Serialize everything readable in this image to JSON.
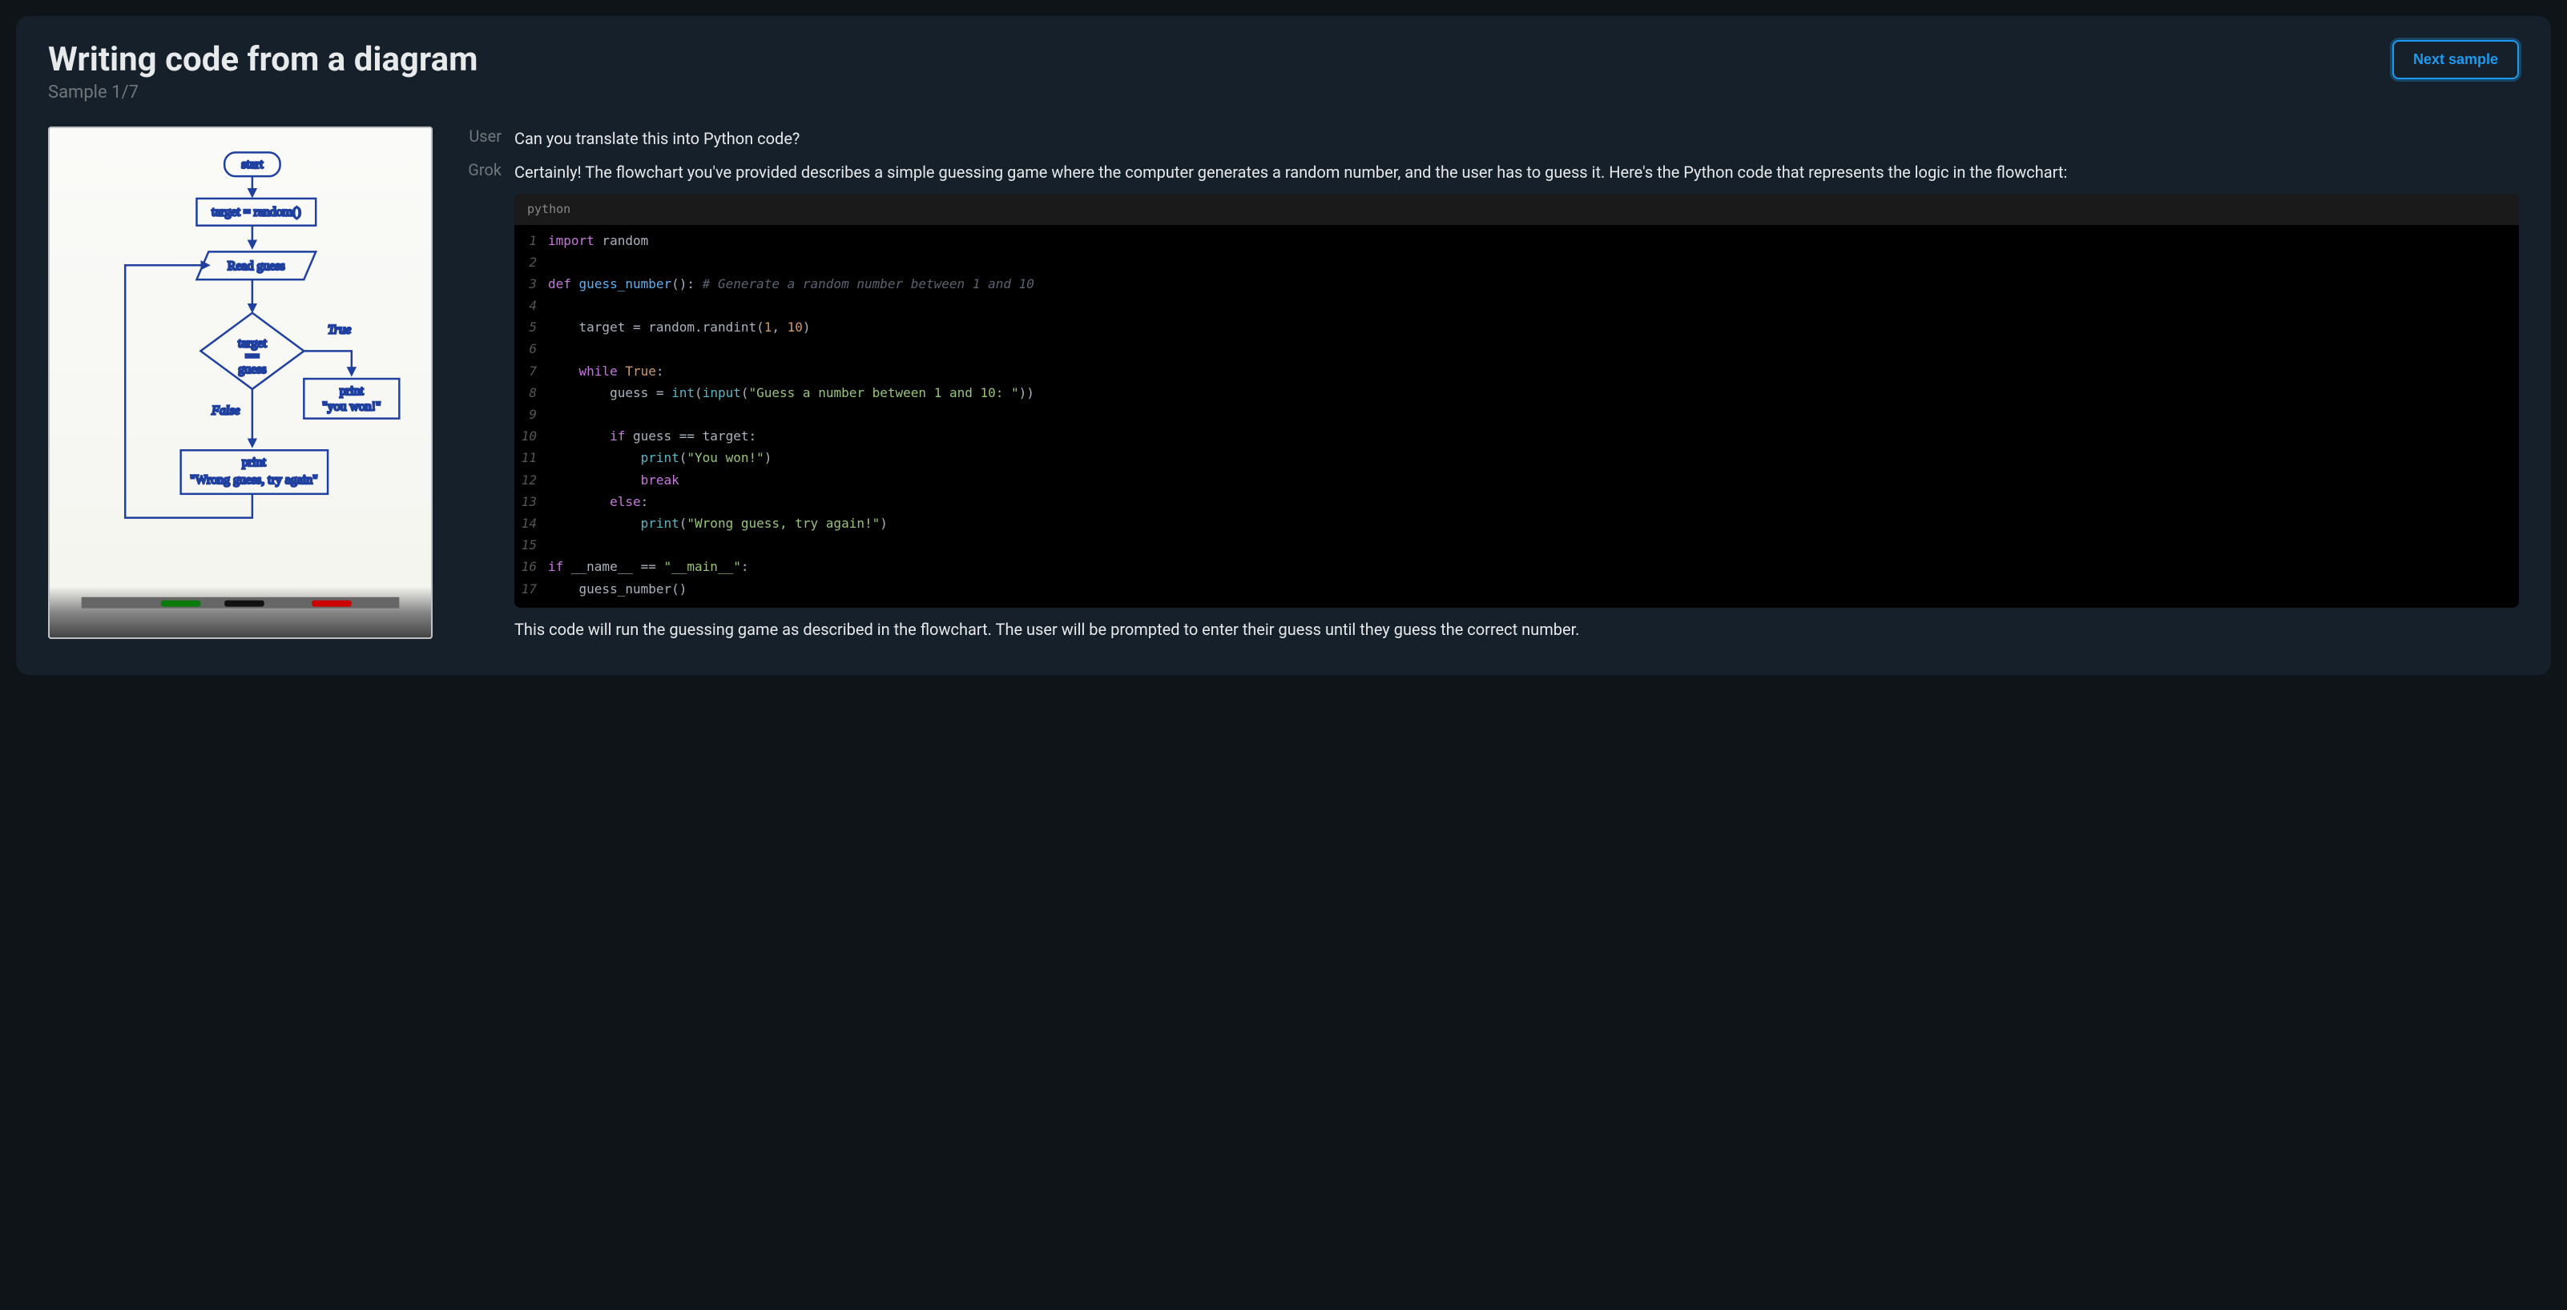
{
  "header": {
    "title": "Writing code from a diagram",
    "sample_label": "Sample 1/7",
    "next_button": "Next sample"
  },
  "conversation": {
    "user_role": "User",
    "assistant_role": "Grok",
    "user_message": "Can you translate this into Python code?",
    "assistant_intro": "Certainly! The flowchart you've provided describes a simple guessing game where the computer generates a random number, and the user has to guess it. Here's the Python code that represents the logic in the flowchart:",
    "assistant_outro": "This code will run the guessing game as described in the flowchart. The user will be prompted to enter their guess until they guess the correct number."
  },
  "code": {
    "language": "python",
    "lines": [
      {
        "n": 1,
        "tokens": [
          [
            "kw",
            "import"
          ],
          [
            "def",
            " random"
          ]
        ]
      },
      {
        "n": 2,
        "tokens": []
      },
      {
        "n": 3,
        "tokens": [
          [
            "kw",
            "def"
          ],
          [
            "def",
            " "
          ],
          [
            "fn",
            "guess_number"
          ],
          [
            "op",
            "(): "
          ],
          [
            "cm",
            "# Generate a random number between 1 and 10"
          ]
        ]
      },
      {
        "n": 4,
        "tokens": []
      },
      {
        "n": 5,
        "tokens": [
          [
            "def",
            "    target "
          ],
          [
            "op",
            "="
          ],
          [
            "def",
            " random.randint("
          ],
          [
            "num",
            "1"
          ],
          [
            "op",
            ", "
          ],
          [
            "num",
            "10"
          ],
          [
            "op",
            ")"
          ]
        ]
      },
      {
        "n": 6,
        "tokens": []
      },
      {
        "n": 7,
        "tokens": [
          [
            "def",
            "    "
          ],
          [
            "kw",
            "while"
          ],
          [
            "def",
            " "
          ],
          [
            "bool",
            "True"
          ],
          [
            "op",
            ":"
          ]
        ]
      },
      {
        "n": 8,
        "tokens": [
          [
            "def",
            "        guess "
          ],
          [
            "op",
            "="
          ],
          [
            "def",
            " "
          ],
          [
            "bkw",
            "int"
          ],
          [
            "op",
            "("
          ],
          [
            "bkw",
            "input"
          ],
          [
            "op",
            "("
          ],
          [
            "str",
            "\"Guess a number between 1 and 10: \""
          ],
          [
            "op",
            "))"
          ]
        ]
      },
      {
        "n": 9,
        "tokens": []
      },
      {
        "n": 10,
        "tokens": [
          [
            "def",
            "        "
          ],
          [
            "kw",
            "if"
          ],
          [
            "def",
            " guess "
          ],
          [
            "op",
            "=="
          ],
          [
            "def",
            " target:"
          ]
        ]
      },
      {
        "n": 11,
        "tokens": [
          [
            "def",
            "            "
          ],
          [
            "bkw",
            "print"
          ],
          [
            "op",
            "("
          ],
          [
            "str",
            "\"You won!\""
          ],
          [
            "op",
            ")"
          ]
        ]
      },
      {
        "n": 12,
        "tokens": [
          [
            "def",
            "            "
          ],
          [
            "kw",
            "break"
          ]
        ]
      },
      {
        "n": 13,
        "tokens": [
          [
            "def",
            "        "
          ],
          [
            "kw",
            "else"
          ],
          [
            "op",
            ":"
          ]
        ]
      },
      {
        "n": 14,
        "tokens": [
          [
            "def",
            "            "
          ],
          [
            "bkw",
            "print"
          ],
          [
            "op",
            "("
          ],
          [
            "str",
            "\"Wrong guess, try again!\""
          ],
          [
            "op",
            ")"
          ]
        ]
      },
      {
        "n": 15,
        "tokens": []
      },
      {
        "n": 16,
        "tokens": [
          [
            "kw",
            "if"
          ],
          [
            "def",
            " __name__ "
          ],
          [
            "op",
            "=="
          ],
          [
            "def",
            " "
          ],
          [
            "str",
            "\"__main__\""
          ],
          [
            "op",
            ":"
          ]
        ]
      },
      {
        "n": 17,
        "tokens": [
          [
            "def",
            "    guess_number()"
          ]
        ]
      }
    ]
  },
  "flowchart": {
    "nodes": [
      "start",
      "target = random()",
      "Read guess",
      "target == guess",
      "True",
      "False",
      "print \"you won!\"",
      "print \"Wrong guess, try again\""
    ]
  }
}
